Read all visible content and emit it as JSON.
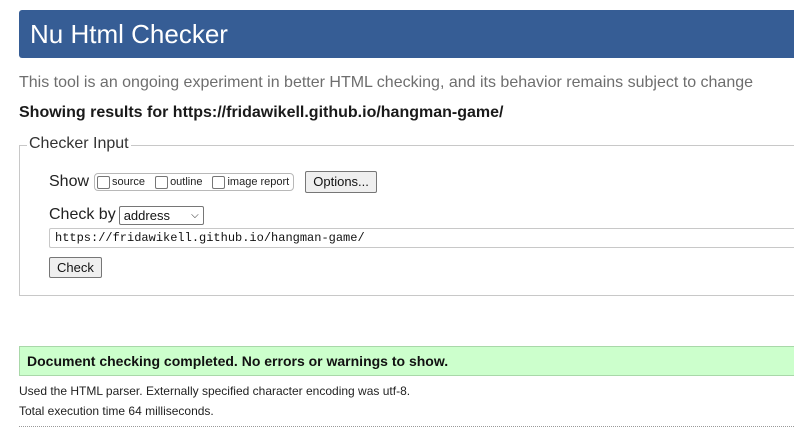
{
  "header": {
    "title": "Nu Html Checker"
  },
  "tagline": "This tool is an ongoing experiment in better HTML checking, and its behavior remains subject to change",
  "results_for": "Showing results for https://fridawikell.github.io/hangman-game/",
  "checker_input": {
    "legend": "Checker Input",
    "show_label": "Show",
    "show_options": [
      {
        "label": "source",
        "checked": false
      },
      {
        "label": "outline",
        "checked": false
      },
      {
        "label": "image report",
        "checked": false
      }
    ],
    "options_button": "Options...",
    "check_by_label": "Check by",
    "check_by_selected": "address",
    "url_value": "https://fridawikell.github.io/hangman-game/",
    "check_button": "Check"
  },
  "result": {
    "message": "Document checking completed. No errors or warnings to show.",
    "parser_info": "Used the HTML parser. Externally specified character encoding was utf-8.",
    "execution_time": "Total execution time 64 milliseconds."
  },
  "colors": {
    "header_bg": "#365d95",
    "success_bg": "#ccffcc"
  }
}
